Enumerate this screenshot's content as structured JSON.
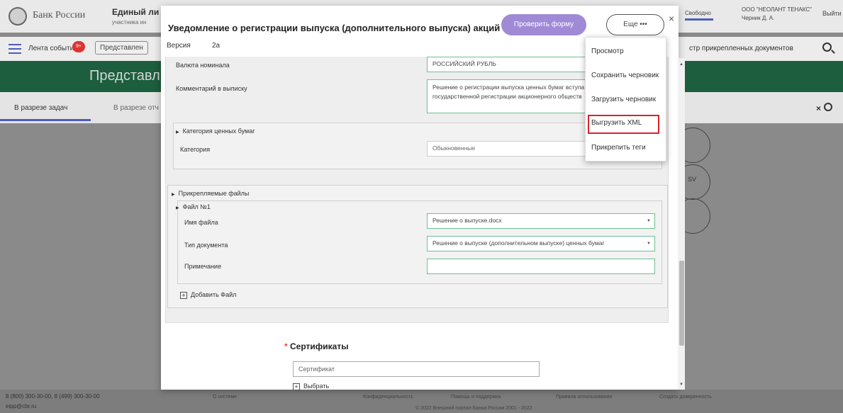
{
  "header": {
    "bank_name": "Банк России",
    "portal_title": "Единый ли",
    "portal_subtitle": "участника ин",
    "status_free": "Свободно",
    "company": "ООО \"НЕОЛАНТ ТЕНАКС\"",
    "user": "Черник Д. А.",
    "logout": "Выйти"
  },
  "nav": {
    "feed": "Лента событий",
    "feed_badge": "9+",
    "representation_btn": "Представлен",
    "registry": "стр прикрепленных документов"
  },
  "banner": {
    "title": "Представл"
  },
  "tabs": {
    "by_tasks": "В разрезе задач",
    "by_reports": "В разрезе отч"
  },
  "bg_misc": {
    "sv": "SV"
  },
  "footer": {
    "phone": "8 (800) 300-30-00, 8 (499) 300-30-00",
    "email": "eipp@cbr.ru",
    "links": [
      "О системе",
      "Конфиденциальность",
      "Помощь и поддержка",
      "Правила использования",
      "Создать доверенность"
    ],
    "copyright": "© 2022 Внешний портал Банка России 2001 - 2022"
  },
  "modal": {
    "title": "Уведомление о регистрации выпуска (дополнительного выпуска) акций",
    "check_button": "Проверить форму",
    "more_button": "Еще •••",
    "close": "×",
    "version_label": "Версия",
    "version_value": "2а",
    "form": {
      "currency_label": "Валюта номинала",
      "currency_value": "РОССИЙСКИЙ РУБЛЬ",
      "comment_label": "Комментарий в выписку",
      "comment_value": "Решение о регистрации выпуска ценных бумаг вступа государственной регистрации акционерного обществ",
      "category_section": "Категория ценных бумаг",
      "category_label": "Категория",
      "category_value": "Обыкновенные",
      "files_section": "Прикрепляемые файлы",
      "file_subsection": "Файл №1",
      "filename_label": "Имя файла",
      "filename_value": "Решение о выпуске.docx",
      "doctype_label": "Тип документа",
      "doctype_value": "Решение о выпуске (дополнительном выпуске) ценных бумаг",
      "note_label": "Примечание",
      "note_value": "",
      "add_file": "Добавить Файл"
    },
    "certificates": {
      "title": "Сертификаты",
      "placeholder": "Сертификат",
      "choose": "Выбрать"
    }
  },
  "dropdown": {
    "items": [
      "Просмотр",
      "Сохранить черновик",
      "Загрузить черновик",
      "Выгрузить XML",
      "Прикрепить теги"
    ],
    "highlighted": "Выгрузить XML"
  },
  "colors": {
    "accent": "#a08ad6",
    "banner": "#1c5e3e",
    "highlight": "#d8222a",
    "field_border": "#6fbf93"
  }
}
